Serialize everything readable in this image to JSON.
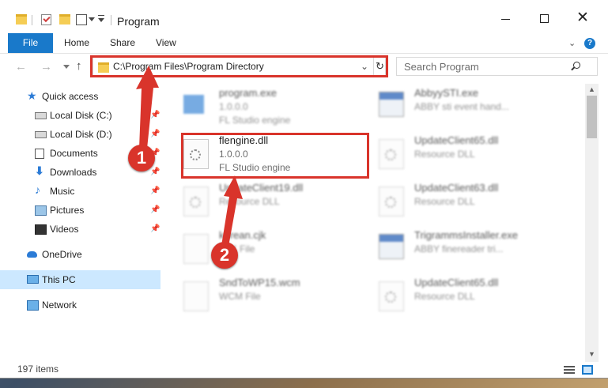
{
  "window": {
    "title": "Program",
    "close_glyph": "✕"
  },
  "ribbon": {
    "tabs": [
      "File",
      "Home",
      "Share",
      "View"
    ],
    "collapse_glyph": "⌄",
    "help_glyph": "?"
  },
  "navbar": {
    "back_glyph": "←",
    "forward_glyph": "→",
    "up_glyph": "↑",
    "address": "C:\\Program Files\\Program Directory",
    "address_dropdown_glyph": "⌄",
    "refresh_glyph": "↻",
    "search_placeholder": "Search Program"
  },
  "sidebar": {
    "pin_glyph": "📌",
    "items": [
      {
        "label": "Quick access",
        "icon": "quick-access-star-icon",
        "glyph": "★",
        "pinned": false
      },
      {
        "label": "Local Disk (C:)",
        "icon": "local-disk-icon",
        "pinned": true
      },
      {
        "label": "Local Disk (D:)",
        "icon": "local-disk-icon",
        "pinned": true
      },
      {
        "label": "Documents",
        "icon": "documents-icon",
        "pinned": true
      },
      {
        "label": "Downloads",
        "icon": "downloads-icon",
        "glyph": "⬇",
        "pinned": true
      },
      {
        "label": "Music",
        "icon": "music-icon",
        "glyph": "♪",
        "pinned": true
      },
      {
        "label": "Pictures",
        "icon": "pictures-icon",
        "pinned": true
      },
      {
        "label": "Videos",
        "icon": "videos-icon",
        "pinned": true
      },
      {
        "label": "OneDrive",
        "icon": "onedrive-icon",
        "pinned": false
      },
      {
        "label": "This PC",
        "icon": "this-pc-icon",
        "pinned": false,
        "selected": true
      },
      {
        "label": "Network",
        "icon": "network-icon",
        "pinned": false
      }
    ]
  },
  "files": [
    {
      "name": "program.exe",
      "line1": "1.0.0.0",
      "line2": "FL Studio engine",
      "icon": "exe-icon",
      "blurred": true
    },
    {
      "name": "AbbyySTI.exe",
      "line1": "ABBY sti event hand...",
      "line2": "",
      "icon": "app-window-icon",
      "blurred": true
    },
    {
      "name": "flengine.dll",
      "line1": "1.0.0.0",
      "line2": "FL Studio engine",
      "icon": "dll-gear-icon",
      "blurred": false,
      "highlighted": true
    },
    {
      "name": "UpdateClient65.dll",
      "line1": "Resource DLL",
      "line2": "",
      "icon": "dll-gear-icon",
      "blurred": true
    },
    {
      "name": "UpdateClient19.dll",
      "line1": "Resource DLL",
      "line2": "",
      "icon": "dll-gear-icon",
      "blurred": true
    },
    {
      "name": "UpdateClient63.dll",
      "line1": "Resource DLL",
      "line2": "",
      "icon": "dll-gear-icon",
      "blurred": true
    },
    {
      "name": "korean.cjk",
      "line1": "CJK File",
      "line2": "",
      "icon": "blank-file-icon",
      "blurred": true
    },
    {
      "name": "TrigrammsInstaller.exe",
      "line1": "ABBY finereader tri...",
      "line2": "",
      "icon": "app-window-icon",
      "blurred": true
    },
    {
      "name": "SndToWP15.wcm",
      "line1": "WCM File",
      "line2": "",
      "icon": "blank-file-icon",
      "blurred": true
    },
    {
      "name": "UpdateClient65.dll",
      "line1": "Resource DLL",
      "line2": "",
      "icon": "dll-gear-icon",
      "blurred": true
    }
  ],
  "annotations": {
    "callout_1": "1",
    "callout_2": "2",
    "highlight_color": "#d9342b"
  },
  "scrollbar": {
    "up_glyph": "▲",
    "down_glyph": "▼"
  },
  "status": {
    "item_count": "197 items"
  },
  "colors": {
    "accent": "#1979ca",
    "selection": "#cce8ff"
  }
}
